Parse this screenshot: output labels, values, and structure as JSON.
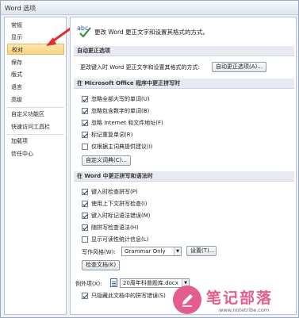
{
  "window": {
    "title": "Word 选项"
  },
  "sidebar": {
    "items": [
      {
        "label": "常规"
      },
      {
        "label": "显示"
      },
      {
        "label": "校对",
        "selected": true
      },
      {
        "label": "保存"
      },
      {
        "label": "版式"
      },
      {
        "label": "语言"
      },
      {
        "label": "高级"
      },
      {
        "label": "自定义功能区"
      },
      {
        "label": "快速访问工具栏"
      },
      {
        "label": "加载项"
      },
      {
        "label": "信任中心"
      }
    ]
  },
  "header": {
    "description": "更改 Word 更正文字和设置其格式的方式。",
    "icon": "abc-check-icon"
  },
  "autocorrect": {
    "section_title": "自动更正选项",
    "description": "更改键入时 Word 更正文字和设置其格式的方式:",
    "button_label": "自动更正选项(A)..."
  },
  "office_spelling": {
    "section_title": "在 Microsoft Office 程序中更正拼写时",
    "options": [
      {
        "label": "忽略全部大写的单词(U)",
        "checked": true
      },
      {
        "label": "忽略包含数字的单词(B)",
        "checked": true
      },
      {
        "label": "忽略 Internet 和文件地址(F)",
        "checked": true
      },
      {
        "label": "标记重复单词(R)",
        "checked": true
      },
      {
        "label": "仅根据主词典提供建议(I)",
        "checked": false
      }
    ],
    "dictionary_button": "自定义词典(C)..."
  },
  "word_spelling": {
    "section_title": "在 Word 中更正拼写和语法时",
    "options": [
      {
        "label": "键入时检查拼写(P)",
        "checked": true
      },
      {
        "label": "使用上下文拼写检查(I)",
        "checked": true
      },
      {
        "label": "键入时标记语法错误(M)",
        "checked": true
      },
      {
        "label": "随拼写检查语法(H)",
        "checked": true
      },
      {
        "label": "显示可读性统计信息(L)",
        "checked": false
      }
    ],
    "writing_style_label": "写作风格(W):",
    "writing_style_value": "Grammar Only",
    "settings_button": "设置(T)...",
    "check_document_button": "检查文档(K)"
  },
  "exceptions": {
    "label": "例外项(X):",
    "document_value": "20周年科普题库.docx",
    "partial_option": "只隐藏此文档中的拼写错误(S)"
  },
  "watermark": {
    "title": "笔记部落",
    "url": "www.notetribe.com"
  },
  "colors": {
    "accent": "#e35d8f",
    "selected_bg": "#f9d37d",
    "arrow": "#e0302a"
  }
}
